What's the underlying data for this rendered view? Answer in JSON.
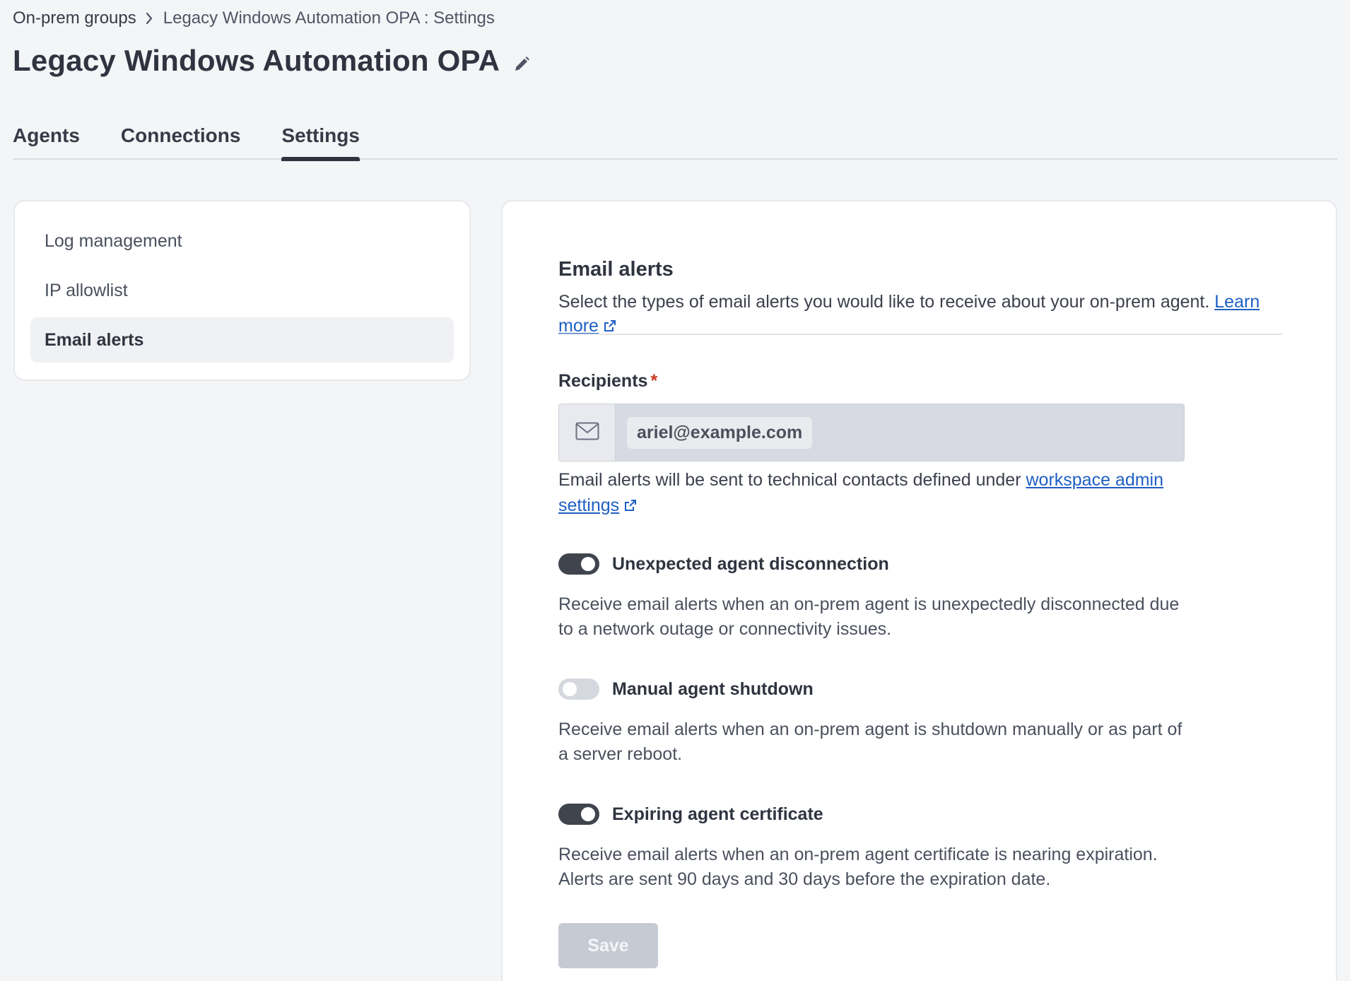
{
  "breadcrumb": {
    "parent": "On-prem groups",
    "current": "Legacy Windows Automation OPA : Settings"
  },
  "header": {
    "title": "Legacy Windows Automation OPA"
  },
  "tabs": [
    {
      "label": "Agents",
      "active": false
    },
    {
      "label": "Connections",
      "active": false
    },
    {
      "label": "Settings",
      "active": true
    }
  ],
  "sidebar": {
    "items": [
      {
        "label": "Log management",
        "active": false
      },
      {
        "label": "IP allowlist",
        "active": false
      },
      {
        "label": "Email alerts",
        "active": true
      }
    ]
  },
  "email_alerts": {
    "title": "Email alerts",
    "description": "Select the types of email alerts you would like to receive about your on-prem agent.",
    "learn_more": "Learn more",
    "recipients_label": "Recipients",
    "required_mark": "*",
    "recipient_email": "ariel@example.com",
    "helper_text": "Email alerts will be sent to technical contacts defined under",
    "helper_link": "workspace admin settings",
    "alerts": [
      {
        "label": "Unexpected agent disconnection",
        "enabled": true,
        "description": "Receive email alerts when an on-prem agent is unexpectedly disconnected due to a network outage or connectivity issues."
      },
      {
        "label": "Manual agent shutdown",
        "enabled": false,
        "description": "Receive email alerts when an on-prem agent is shutdown manually or as part of a server reboot."
      },
      {
        "label": "Expiring agent certificate",
        "enabled": true,
        "description": "Receive email alerts when an on-prem agent certificate is nearing expiration. Alerts are sent 90 days and 30 days before the expiration date."
      }
    ],
    "save_label": "Save"
  },
  "colors": {
    "link": "#1f5fc4",
    "toggle_on": "#40444d",
    "toggle_off": "#d5d8de",
    "required": "#c9391f",
    "save_disabled": "#c6cad3"
  }
}
